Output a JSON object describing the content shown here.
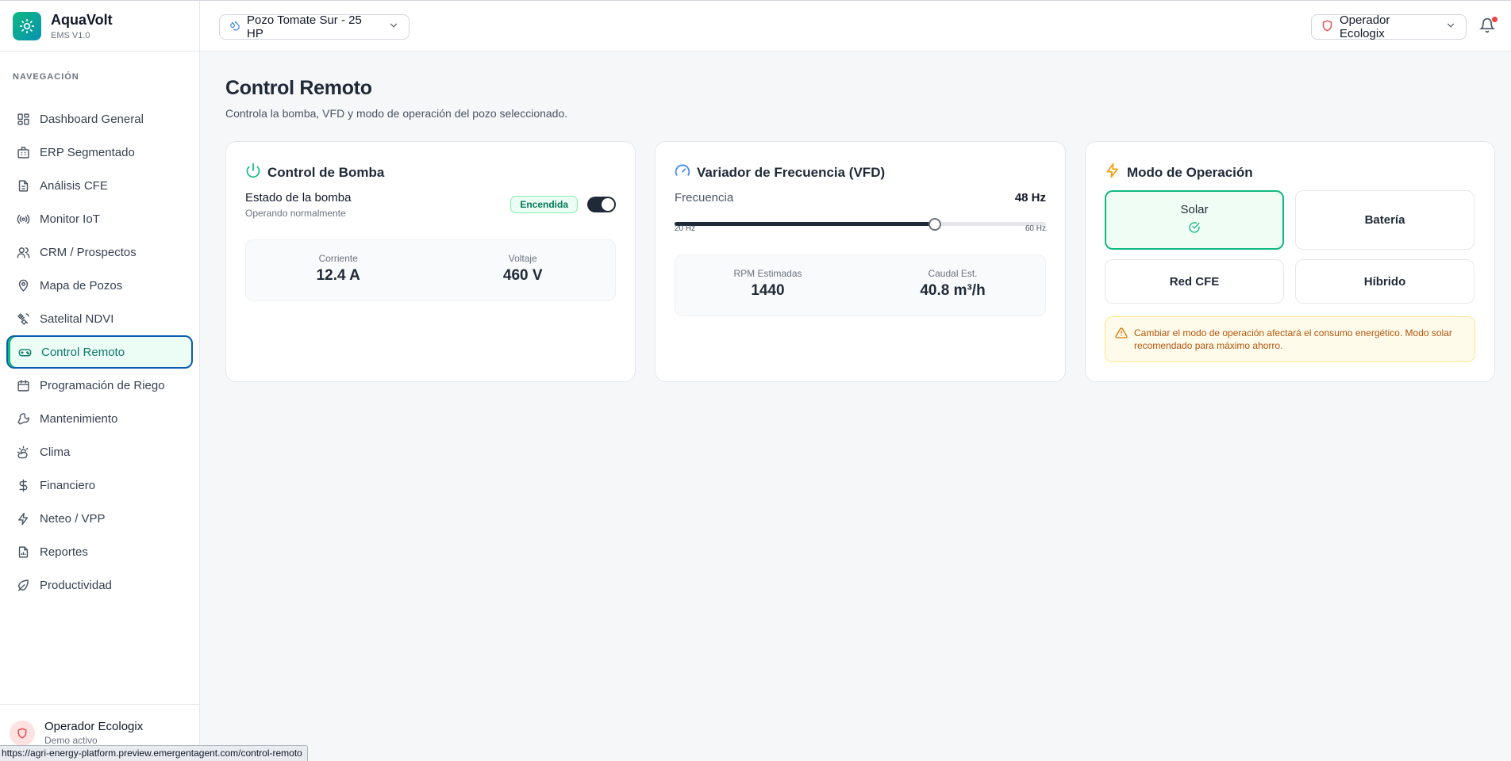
{
  "app": {
    "name": "AquaVolt",
    "version": "EMS V1.0"
  },
  "sidebar": {
    "section_label": "NAVEGACIÓN",
    "items": [
      {
        "label": "Dashboard General",
        "icon": "dashboard-icon"
      },
      {
        "label": "ERP Segmentado",
        "icon": "building-icon"
      },
      {
        "label": "Análisis CFE",
        "icon": "document-icon"
      },
      {
        "label": "Monitor IoT",
        "icon": "radio-icon"
      },
      {
        "label": "CRM / Prospectos",
        "icon": "users-icon"
      },
      {
        "label": "Mapa de Pozos",
        "icon": "map-pin-icon"
      },
      {
        "label": "Satelital NDVI",
        "icon": "satellite-icon"
      },
      {
        "label": "Control Remoto",
        "icon": "gamepad-icon",
        "active": true
      },
      {
        "label": "Programación de Riego",
        "icon": "calendar-icon"
      },
      {
        "label": "Mantenimiento",
        "icon": "wrench-icon"
      },
      {
        "label": "Clima",
        "icon": "cloud-sun-icon"
      },
      {
        "label": "Financiero",
        "icon": "dollar-icon"
      },
      {
        "label": "Neteo / VPP",
        "icon": "lightning-icon"
      },
      {
        "label": "Reportes",
        "icon": "report-icon"
      },
      {
        "label": "Productividad",
        "icon": "leaf-icon"
      }
    ],
    "footer": {
      "user_name": "Operador Ecologix",
      "user_status": "Demo activo"
    }
  },
  "header": {
    "well_selector": "Pozo Tomate Sur - 25 HP",
    "role_selector": "Operador Ecologix",
    "has_notification": true
  },
  "page": {
    "title": "Control Remoto",
    "subtitle": "Controla la bomba, VFD y modo de operación del pozo seleccionado."
  },
  "pump_card": {
    "title": "Control de Bomba",
    "state_label": "Estado de la bomba",
    "state_sub": "Operando normalmente",
    "badge": "Encendida",
    "toggle_on": true,
    "current_label": "Corriente",
    "current_value": "12.4 A",
    "voltage_label": "Voltaje",
    "voltage_value": "460 V"
  },
  "vfd_card": {
    "title": "Variador de Frecuencia (VFD)",
    "freq_label": "Frecuencia",
    "freq_value": "48 Hz",
    "freq_min_label": "20 Hz",
    "freq_max_label": "60 Hz",
    "freq_current": 48,
    "freq_min": 20,
    "freq_max": 60,
    "rpm_label": "RPM Estimadas",
    "rpm_value": "1440",
    "flow_label": "Caudal Est.",
    "flow_value": "40.8 m³/h"
  },
  "mode_card": {
    "title": "Modo de Operación",
    "modes": [
      {
        "label": "Solar",
        "selected": true
      },
      {
        "label": "Batería",
        "selected": false
      },
      {
        "label": "Red CFE",
        "selected": false
      },
      {
        "label": "Híbrido",
        "selected": false
      }
    ],
    "warning": "Cambiar el modo de operación afectará el consumo energético. Modo solar recomendado para máximo ahorro."
  },
  "statusbar": {
    "url": "https://agri-energy-platform.preview.emergentagent.com/control-remoto"
  },
  "colors": {
    "accent": "#10b981",
    "warning_text": "#b45309",
    "warning_bg": "#fffbeb",
    "active_border": "#0b5cad"
  }
}
